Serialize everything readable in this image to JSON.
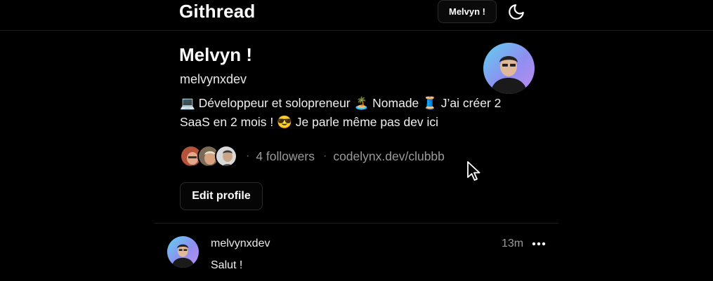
{
  "header": {
    "brand": "Githread",
    "user_button_label": "Melvyn !",
    "theme_toggle_icon": "moon-icon"
  },
  "profile": {
    "name": "Melvyn !",
    "handle": "melvynxdev",
    "bio": "💻 Développeur et solopreneur 🏝️ Nomade 🧵 J’ai créer 2\nSaaS en 2 mois ! 😎 Je parle même pas dev ici",
    "followers_text": "4 followers",
    "link_text": "codelynx.dev/clubbb",
    "edit_button_label": "Edit profile"
  },
  "posts": [
    {
      "username": "melvynxdev",
      "time": "13m",
      "body": "Salut !",
      "more_icon": "more-horizontal-icon"
    }
  ],
  "colors": {
    "background": "#000000",
    "text": "#ffffff",
    "muted": "#9a9a9a",
    "border": "#2a2a2a"
  }
}
